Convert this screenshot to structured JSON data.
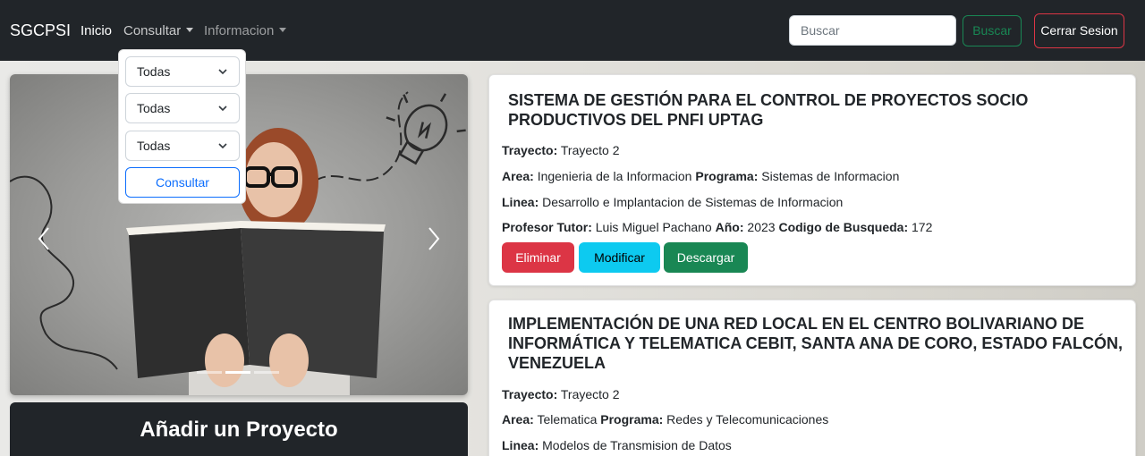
{
  "nav": {
    "brand": "SGCPSI",
    "links": [
      {
        "label": "Inicio"
      },
      {
        "label": "Consultar"
      },
      {
        "label": "Informacion"
      }
    ],
    "search_placeholder": "Buscar",
    "search_button": "Buscar",
    "logout_button": "Cerrar Sesion"
  },
  "dropdown": {
    "selects": [
      "Todas",
      "Todas",
      "Todas"
    ],
    "submit_label": "Consultar"
  },
  "carousel": {
    "slide_count": 3,
    "active_slide": 2
  },
  "add_panel": {
    "title": "Añadir un Proyecto"
  },
  "labels": {
    "trayecto": "Trayecto:",
    "area": "Area:",
    "programa": "Programa:",
    "linea": "Linea:",
    "tutor": "Profesor Tutor:",
    "anio": "Año:",
    "codigo": "Codigo de Busqueda:"
  },
  "projects": [
    {
      "title": "SISTEMA DE GESTIÓN PARA EL CONTROL DE PROYECTOS SOCIO PRODUCTIVOS DEL PNFI UPTAG",
      "trayecto": "Trayecto 2",
      "area": "Ingenieria de la Informacion",
      "programa": "Sistemas de Informacion",
      "linea": "Desarrollo e Implantacion de Sistemas de Informacion",
      "tutor": "Luis Miguel Pachano",
      "anio": "2023",
      "codigo": "172",
      "actions": {
        "delete": "Eliminar",
        "edit": "Modificar",
        "download": "Descargar"
      }
    },
    {
      "title": "IMPLEMENTACIÓN DE UNA RED LOCAL EN EL CENTRO BOLIVARIANO DE INFORMÁTICA Y TELEMATICA CEBIT, SANTA ANA DE CORO, ESTADO FALCÓN, VENEZUELA",
      "trayecto": "Trayecto 2",
      "area": "Telematica",
      "programa": "Redes y Telecomunicaciones",
      "linea": "Modelos de Transmision de Datos"
    }
  ],
  "colors": {
    "navbar": "#212529",
    "danger": "#dc3545",
    "info": "#0dcaf0",
    "success": "#198754",
    "primary": "#0d6efd"
  }
}
